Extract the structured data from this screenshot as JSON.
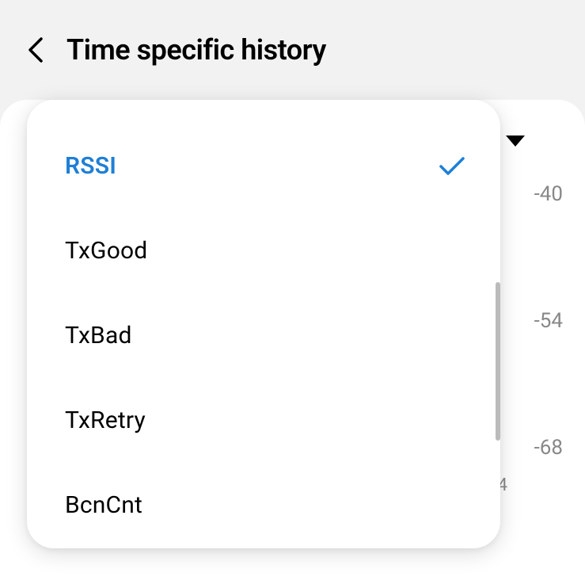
{
  "header": {
    "title": "Time specific history"
  },
  "axis": {
    "labels": [
      "-40",
      "-54",
      "-68"
    ],
    "stray": "4"
  },
  "menu": {
    "items": [
      {
        "label": "RSSI",
        "selected": true
      },
      {
        "label": "TxGood",
        "selected": false
      },
      {
        "label": "TxBad",
        "selected": false
      },
      {
        "label": "TxRetry",
        "selected": false
      },
      {
        "label": "BcnCnt",
        "selected": false
      }
    ]
  }
}
